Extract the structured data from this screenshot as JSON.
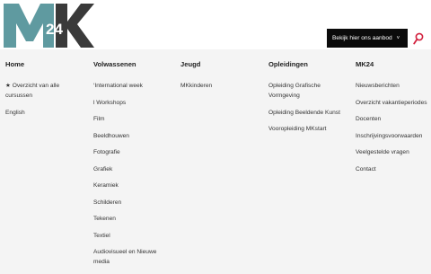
{
  "logo": {
    "text": "MK",
    "superscript": "24"
  },
  "header": {
    "cta_label": "Bekijk hier ons aanbod",
    "cta_chevron": "˅",
    "search_icon": "search-icon"
  },
  "colors": {
    "accent": "#d21f3c",
    "logo_teal": "#5f9aa0",
    "logo_dark": "#3a3a3a",
    "cta_bg": "#0b0b0b",
    "menu_bg": "#f4f4f4"
  },
  "menu": {
    "columns": [
      {
        "heading": "Home",
        "items": [
          "★ Overzicht van alle cursussen",
          "English"
        ]
      },
      {
        "heading": "Volwassenen",
        "items": [
          "‘International week",
          "l Workshops",
          "Film",
          "Beeldhouwen",
          "Fotografie",
          "Grafiek",
          "Keramiek",
          "Schilderen",
          "Tekenen",
          "Textiel",
          "Audiovisueel en Nieuwe media"
        ]
      },
      {
        "heading": "Jeugd",
        "items": [
          "MKkinderen"
        ]
      },
      {
        "heading": "Opleidingen",
        "items": [
          "Opleiding Grafische Vormgeving",
          "Opleiding Beeldende Kunst",
          "Vooropleiding MKstart"
        ]
      },
      {
        "heading": "MK24",
        "items": [
          "Nieuwsberichten",
          "Overzicht vakantieperiodes",
          "Docenten",
          "Inschrijvingsvoorwaarden",
          "Veelgestelde vragen",
          "Contact"
        ]
      }
    ]
  }
}
